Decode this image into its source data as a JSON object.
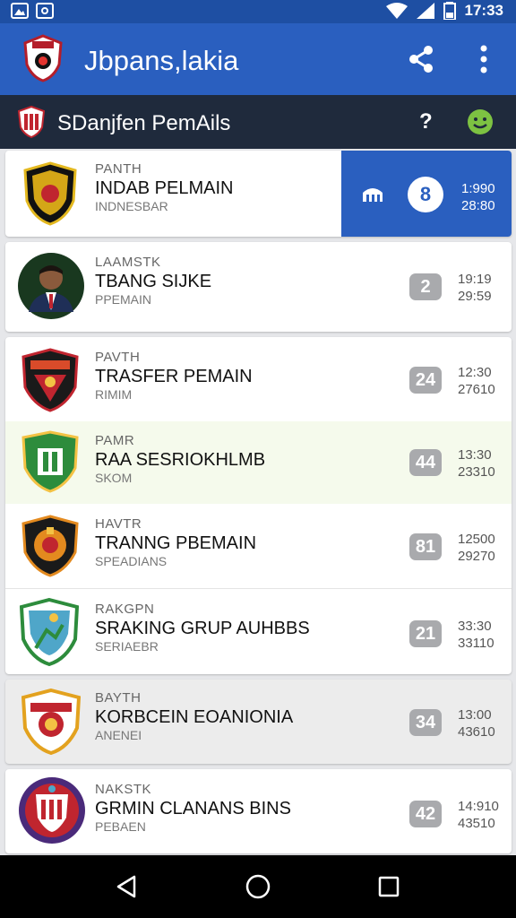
{
  "status_bar": {
    "time": "17:33"
  },
  "app_bar": {
    "title": "Jbpans,lakia"
  },
  "sub_bar": {
    "title": "SDanjfen PemAils",
    "help": "?"
  },
  "rows": [
    {
      "line1": "PANTH",
      "line2": "INDAB PELMAIN",
      "line3": "INDNESBAR",
      "badge": "8",
      "n1": "1:990",
      "n2": "28:80",
      "selected": true
    },
    {
      "line1": "LAAMSTK",
      "line2": "TBANG SIJKE",
      "line3": "PPEMAIN",
      "badge": "2",
      "n1": "19:19",
      "n2": "29:59"
    },
    {
      "line1": "PAVTH",
      "line2": "TRASFER PEMAIN",
      "line3": "RIMIM",
      "badge": "24",
      "n1": "12:30",
      "n2": "27610"
    },
    {
      "line1": "PAMR",
      "line2": "RAA SESRIOKHLMB",
      "line3": "SKOM",
      "badge": "44",
      "n1": "13:30",
      "n2": "23310"
    },
    {
      "line1": "HAVTR",
      "line2": "TRANNG PBEMAIN",
      "line3": "SPEADIANS",
      "badge": "81",
      "n1": "12500",
      "n2": "29270"
    },
    {
      "line1": "RAKGPN",
      "line2": "SRAKING GRUP AUHBBS",
      "line3": "SERIAEBR",
      "badge": "21",
      "n1": "33:30",
      "n2": "33110"
    },
    {
      "line1": "BAYTH",
      "line2": "KORBCEIN EOANIONIA",
      "line3": "ANENEI",
      "badge": "34",
      "n1": "13:00",
      "n2": "43610"
    },
    {
      "line1": "NAKSTK",
      "line2": "GRMIN CLANANS BINS",
      "line3": "PEBAEN",
      "badge": "42",
      "n1": "14:910",
      "n2": "43510"
    }
  ],
  "colors": {
    "primary": "#2a5fbf",
    "status": "#1e4fa3",
    "subbar": "#1f2a3c",
    "accent_green": "#7dc242"
  },
  "icons": {
    "share": "share-icon",
    "more": "more-vert-icon",
    "help": "help-icon",
    "smile": "smile-icon",
    "back": "back-triangle-icon",
    "home": "home-circle-icon",
    "recents": "recents-square-icon"
  }
}
